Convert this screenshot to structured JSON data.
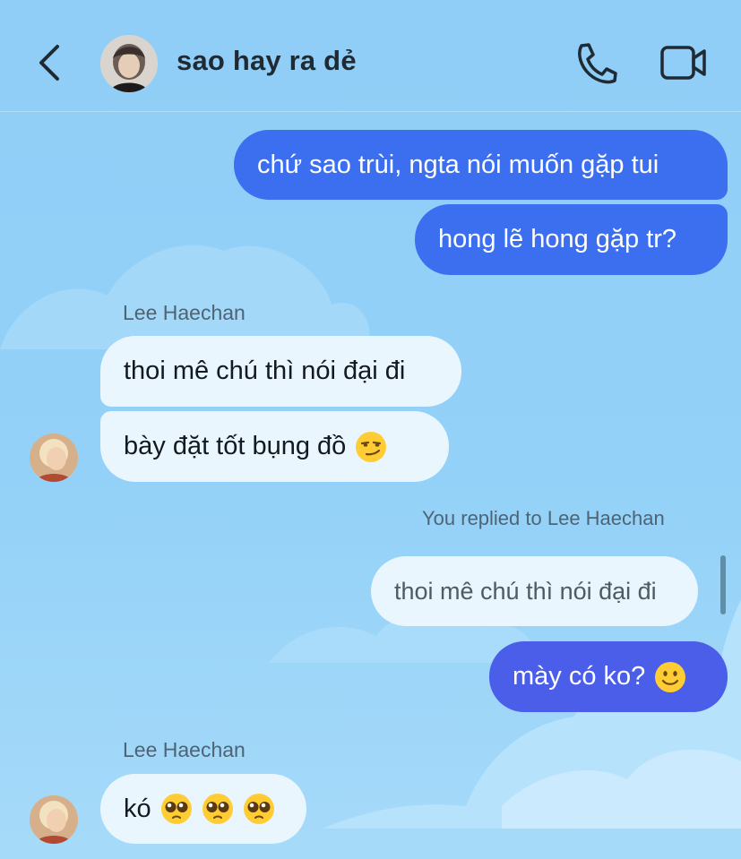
{
  "header": {
    "title": "sao hay ra dẻ",
    "back_icon": "chevron-left-icon",
    "call_icon": "phone-icon",
    "video_icon": "video-camera-icon"
  },
  "messages": [
    {
      "direction": "outgoing",
      "text": "chứ sao trùi, ngta nói muốn gặp tui"
    },
    {
      "direction": "outgoing",
      "text": "hong lẽ hong gặp tr?"
    },
    {
      "direction": "incoming",
      "sender": "Lee Haechan",
      "text": "thoi mê chú thì nói đại đi"
    },
    {
      "direction": "incoming",
      "text": "bày đặt tốt bụng đồ",
      "emoji": "smirk"
    },
    {
      "direction": "outgoing",
      "reply_label": "You replied to Lee Haechan",
      "quoted_text": "thoi mê chú thì nói đại đi"
    },
    {
      "direction": "outgoing",
      "text": "mày có ko?",
      "emoji": "slight-smile"
    },
    {
      "direction": "incoming",
      "sender": "Lee Haechan",
      "text": "kó",
      "emoji": [
        "pleading",
        "pleading",
        "pleading"
      ]
    }
  ],
  "colors": {
    "background": "#93d0f8",
    "outgoing_bubble": "#3b6ff0",
    "outgoing_bubble_alt": "#4a5ee9",
    "incoming_bubble": "#eaf6fd"
  }
}
